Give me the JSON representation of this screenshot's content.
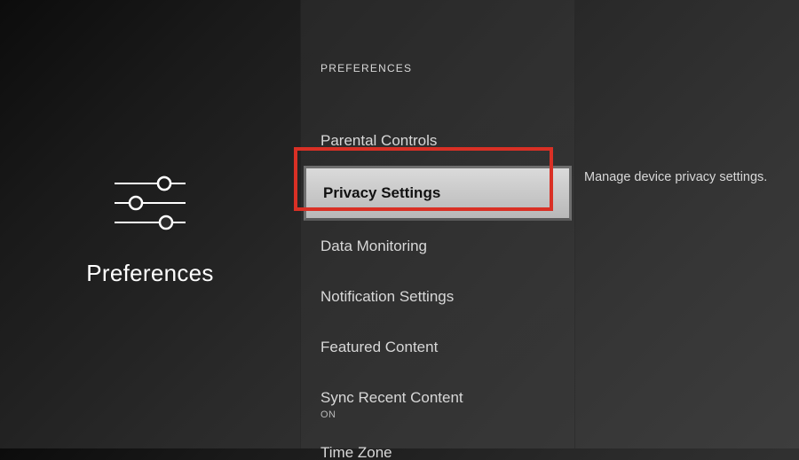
{
  "left": {
    "title": "Preferences"
  },
  "section_header": "PREFERENCES",
  "menu": {
    "items": [
      {
        "label": "Parental Controls"
      },
      {
        "label": "Privacy Settings",
        "selected": true
      },
      {
        "label": "Data Monitoring"
      },
      {
        "label": "Notification Settings"
      },
      {
        "label": "Featured Content"
      },
      {
        "label": "Sync Recent Content",
        "sub": "ON"
      },
      {
        "label": "Time Zone"
      }
    ]
  },
  "detail": {
    "description": "Manage device privacy settings."
  }
}
